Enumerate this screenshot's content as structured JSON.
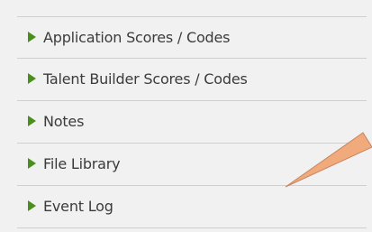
{
  "sections": [
    {
      "label": "Application Scores / Codes"
    },
    {
      "label": "Talent Builder Scores / Codes"
    },
    {
      "label": "Notes"
    },
    {
      "label": "File Library"
    },
    {
      "label": "Event Log"
    }
  ],
  "colors": {
    "background": "#f1f1f1",
    "triangle": "#4a8f1b",
    "text": "#3b3b3b",
    "divider": "#cfcfcf",
    "callout_pointer": "#f0aa7c",
    "callout_pointer_outline": "#c98561"
  },
  "icons": {
    "expand": "caret-right-icon",
    "callout": "callout-pointer"
  }
}
